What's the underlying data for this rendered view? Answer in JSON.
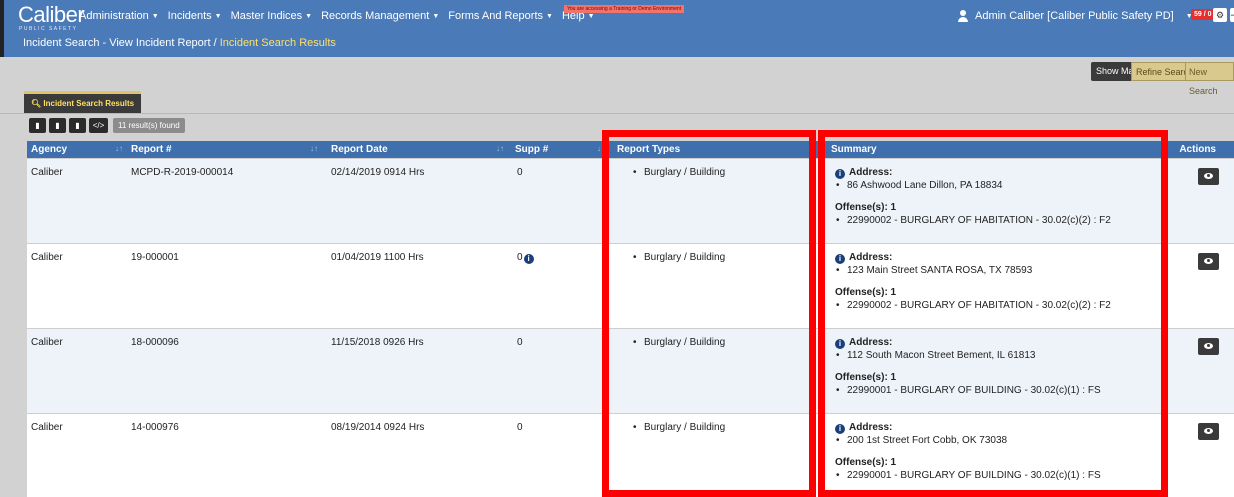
{
  "header": {
    "logo": "Caliber",
    "logo_sub": "PUBLIC SAFETY",
    "nav": [
      "Administration",
      "Incidents",
      "Master Indices",
      "Records Management",
      "Forms And Reports",
      "Help"
    ],
    "env_notice": "You are accessing a Training or Demo Environment",
    "breadcrumb": {
      "parent": "Incident Search - View Incident Report",
      "separator": "/",
      "current": "Incident Search Results"
    },
    "user": "Admin Caliber [Caliber Public Safety PD]",
    "counter": "59 / 0"
  },
  "toolbar": {
    "show_map": "Show Map",
    "refine": "Refine Search",
    "new_search": "New Search"
  },
  "tab": {
    "label": "Incident Search Results"
  },
  "results": {
    "count_label": "11 result(s) found"
  },
  "table": {
    "headers": [
      "Agency",
      "Report #",
      "Report Date",
      "Supp #",
      "Report Types",
      "Summary",
      "Actions"
    ],
    "address_label": "Address:",
    "rows": [
      {
        "agency": "Caliber",
        "report": "MCPD-R-2019-000014",
        "date": "02/14/2019 0914 Hrs",
        "supp": "0",
        "type": "Burglary / Building",
        "address": "86 Ashwood Lane Dillon, PA 18834",
        "offense_label": "Offense(s): 1",
        "offense": "22990002 - BURGLARY OF HABITATION - 30.02(c)(2) : F2"
      },
      {
        "agency": "Caliber",
        "report": "19-000001",
        "date": "01/04/2019 1100 Hrs",
        "supp": "0",
        "type": "Burglary / Building",
        "address": "123 Main Street SANTA ROSA, TX 78593",
        "offense_label": "Offense(s): 1",
        "offense": "22990002 - BURGLARY OF HABITATION - 30.02(c)(2) : F2"
      },
      {
        "agency": "Caliber",
        "report": "18-000096",
        "date": "11/15/2018 0926 Hrs",
        "supp": "0",
        "type": "Burglary / Building",
        "address": "112 South Macon Street Bement, IL 61813",
        "offense_label": "Offense(s): 1",
        "offense": "22990001 - BURGLARY OF BUILDING - 30.02(c)(1) : FS"
      },
      {
        "agency": "Caliber",
        "report": "14-000976",
        "date": "08/19/2014 0924 Hrs",
        "supp": "0",
        "type": "Burglary / Building",
        "address": "200 1st Street Fort Cobb, OK 73038",
        "offense_label": "Offense(s): 1",
        "offense": "22990001 - BURGLARY OF BUILDING - 30.02(c)(1) : FS"
      }
    ]
  },
  "colors": {
    "header_bg": "#4a7ab8",
    "table_header": "#3f6fad",
    "highlight": "#ff0000",
    "row_alt": "#eef3f9"
  }
}
